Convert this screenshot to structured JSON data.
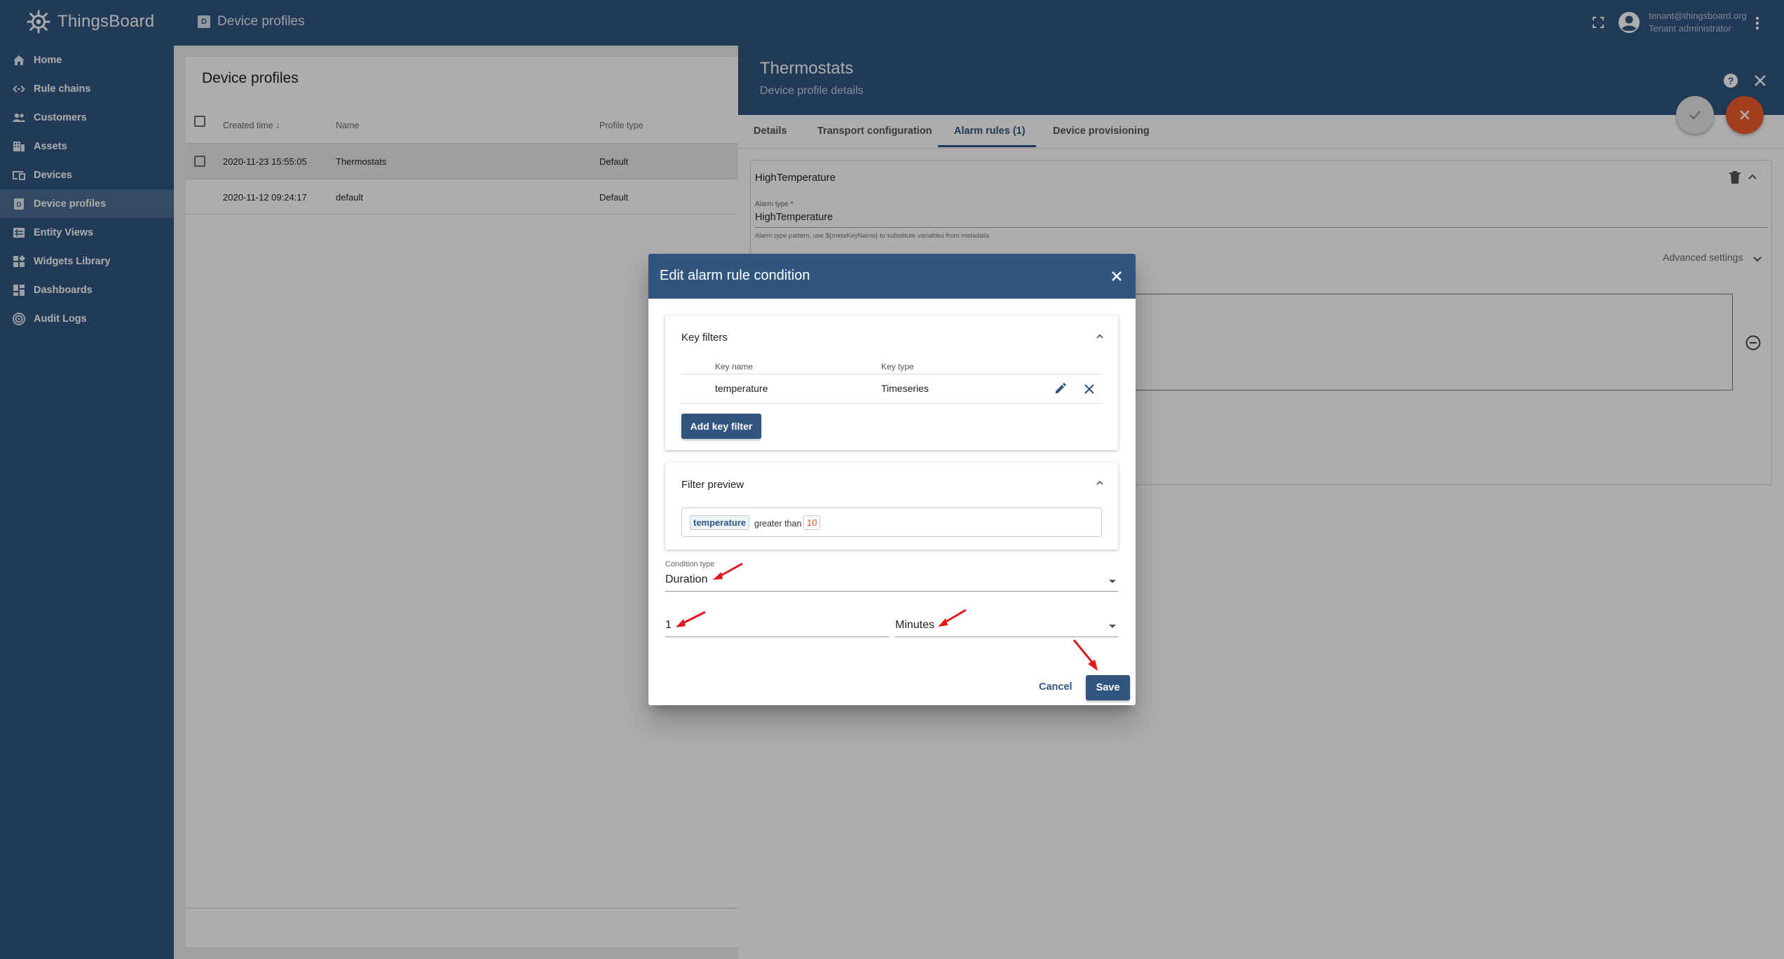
{
  "app": {
    "name": "ThingsBoard",
    "breadcrumb": "Device profiles",
    "user_email": "tenant@thingsboard.org",
    "user_role": "Tenant administrator",
    "brand_color": "#305680",
    "accent_color": "#ef5b2c"
  },
  "sidebar": {
    "items": [
      {
        "label": "Home",
        "icon": "home-icon"
      },
      {
        "label": "Rule chains",
        "icon": "rule-chains-icon"
      },
      {
        "label": "Customers",
        "icon": "customers-icon"
      },
      {
        "label": "Assets",
        "icon": "assets-icon"
      },
      {
        "label": "Devices",
        "icon": "devices-icon"
      },
      {
        "label": "Device profiles",
        "icon": "device-profiles-icon",
        "active": true
      },
      {
        "label": "Entity Views",
        "icon": "entity-views-icon"
      },
      {
        "label": "Widgets Library",
        "icon": "widgets-library-icon"
      },
      {
        "label": "Dashboards",
        "icon": "dashboards-icon"
      },
      {
        "label": "Audit Logs",
        "icon": "audit-logs-icon"
      }
    ]
  },
  "list": {
    "title": "Device profiles",
    "columns": [
      "Created time",
      "Name",
      "Profile type"
    ],
    "rows": [
      {
        "created": "2020-11-23 15:55:05",
        "name": "Thermostats",
        "type": "Default"
      },
      {
        "created": "2020-11-12 09:24:17",
        "name": "default",
        "type": "Default"
      }
    ]
  },
  "panel": {
    "title": "Thermostats",
    "subtitle": "Device profile details",
    "tabs": [
      "Details",
      "Transport configuration",
      "Alarm rules (1)",
      "Device provisioning"
    ],
    "active_tab": "Alarm rules (1)",
    "rule_name": "HighTemperature",
    "alarm_type_label": "Alarm type *",
    "alarm_type_value": "HighTemperature",
    "alarm_type_hint": "Alarm type pattern, use ${metaKeyName} to substitute variables from metadata",
    "advanced_settings": "Advanced settings"
  },
  "dialog": {
    "title": "Edit alarm rule condition",
    "key_filters": {
      "title": "Key filters",
      "col_key_name": "Key name",
      "col_key_type": "Key type",
      "rows": [
        {
          "key_name": "temperature",
          "key_type": "Timeseries"
        }
      ],
      "add_button": "Add key filter"
    },
    "filter_preview": {
      "title": "Filter preview",
      "key": "temperature",
      "operator": "greater than",
      "value": "10"
    },
    "condition_type_label": "Condition type",
    "condition_type_value": "Duration",
    "duration_value": "1",
    "duration_unit": "Minutes",
    "cancel": "Cancel",
    "save": "Save"
  }
}
